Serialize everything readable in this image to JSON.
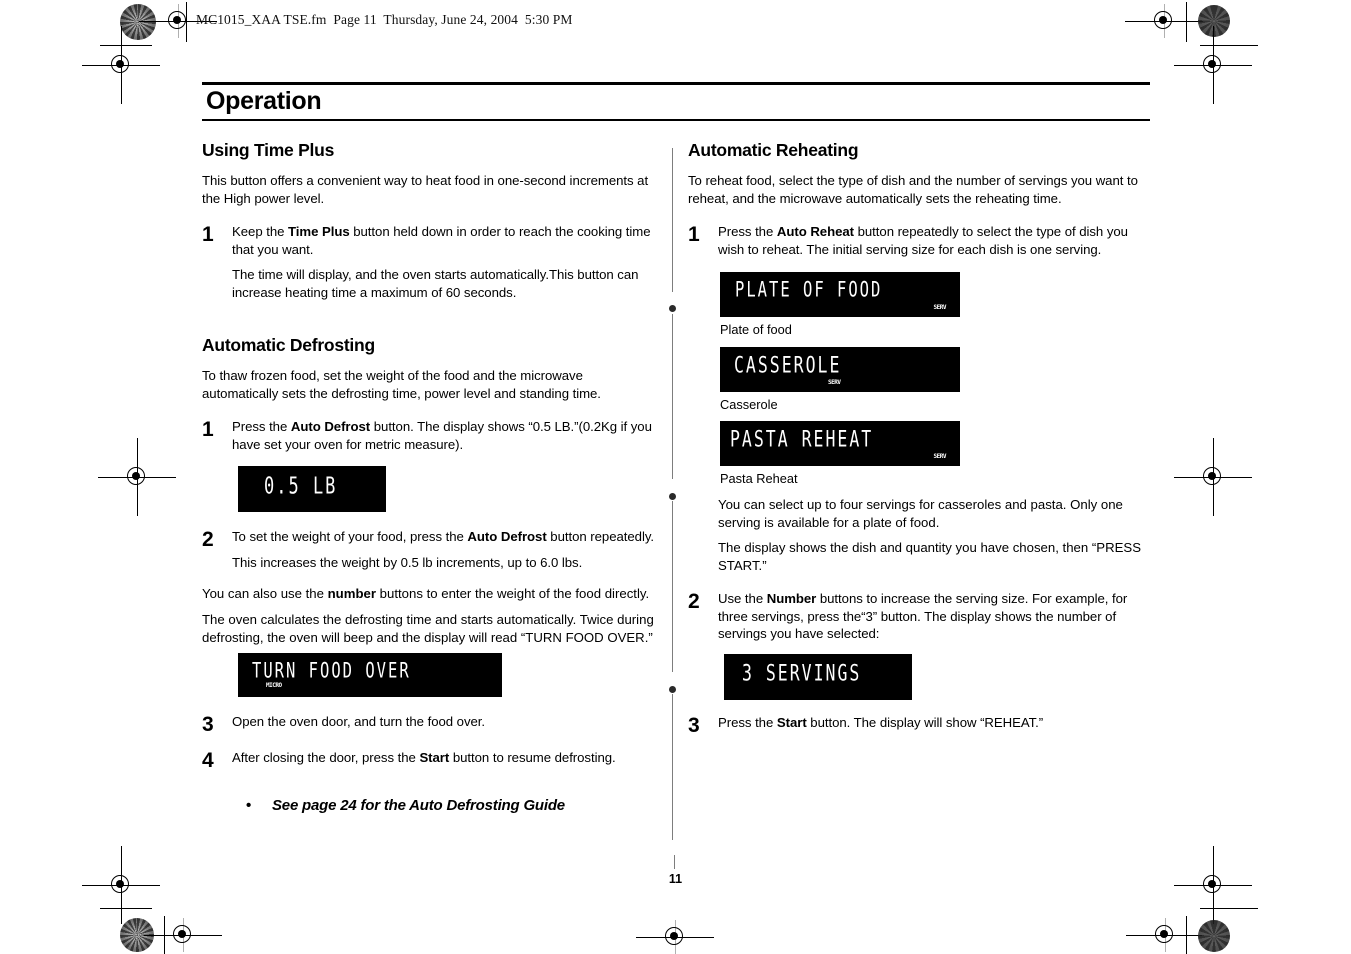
{
  "document": {
    "header_line": "MC1015_XAA TSE.fm  Page 11  Thursday, June 24, 2004  5:30 PM",
    "page_title": "Operation",
    "page_number": "11"
  },
  "left_column": {
    "section1": {
      "heading": "Using Time Plus",
      "intro": "This button offers a convenient way to heat food in one-second increments at the High power level.",
      "steps": [
        {
          "num": "1",
          "line1_pre": "Keep the ",
          "line1_bold": "Time Plus",
          "line1_post": " button held down in order to reach the cooking time that you want.",
          "line2": "The time will display, and the oven starts automatically.This button can increase heating time a maximum of 60 seconds."
        }
      ]
    },
    "section2": {
      "heading": "Automatic Defrosting",
      "intro": "To thaw frozen food, set the weight of the food and the microwave automatically sets the defrosting time, power level and standing time.",
      "step1": {
        "num": "1",
        "pre": "Press the ",
        "bold": "Auto Defrost",
        "post": " button.  The display shows “0.5 LB.”(0.2Kg if you have set your oven for metric measure)."
      },
      "display1": {
        "text": "0.5 LB",
        "indicator": ""
      },
      "step2": {
        "num": "2",
        "pre": "To set the weight of your food, press the ",
        "bold": "Auto Defrost",
        "post": " button repeatedly.",
        "sub": "This increases the weight by 0.5 lb increments, up to 6.0 lbs."
      },
      "para_number_pre": "You can also use the ",
      "para_number_bold": "number",
      "para_number_post": " buttons to enter the weight of the food directly.",
      "para_oven": "The oven calculates the defrosting time and starts automatically.  Twice during defrosting, the oven will beep and the display will read “TURN FOOD OVER.”",
      "display2": {
        "text": "TURN FOOD OVER",
        "indicator": "MICRO"
      },
      "step3": {
        "num": "3",
        "text": "Open the oven door, and turn the food over."
      },
      "step4": {
        "num": "4",
        "pre": "After closing the door, press the ",
        "bold": "Start",
        "post": " button to resume defrosting."
      },
      "note": "See page 24 for the Auto Defrosting  Guide",
      "note_bullet": "•"
    }
  },
  "right_column": {
    "section1": {
      "heading": "Automatic Reheating",
      "intro": "To reheat food, select the type of dish and the number of servings you want to reheat, and the microwave automatically sets the reheating time.",
      "step1": {
        "num": "1",
        "pre": "Press the ",
        "bold": "Auto Reheat",
        "post": " button repeatedly to select the type of dish you wish to reheat. The initial serving size for each dish is one serving."
      },
      "displays": [
        {
          "text": "PLATE OF FOOD",
          "indicator": "SERV",
          "caption": "Plate of food"
        },
        {
          "text": "CASSEROLE",
          "indicator": "SERV",
          "caption": "Casserole"
        },
        {
          "text": "PASTA REHEAT",
          "indicator": "SERV",
          "caption": "Pasta Reheat"
        }
      ],
      "para_servings": "You can select up to four servings for casseroles and pasta. Only one serving is  available for a plate of food.",
      "para_display": "The display shows the dish and quantity you have chosen, then “PRESS START.”",
      "step2": {
        "num": "2",
        "pre": "Use the ",
        "bold": "Number",
        "post": " buttons to increase the serving size.  For example, for three servings, press the“3” button.  The display shows the number of servings you have selected:"
      },
      "display_servings": {
        "text": "3 SERVINGS",
        "indicator": ""
      },
      "step3": {
        "num": "3",
        "pre": "Press the ",
        "bold": "Start",
        "post": " button. The display will show “REHEAT.”"
      }
    }
  }
}
